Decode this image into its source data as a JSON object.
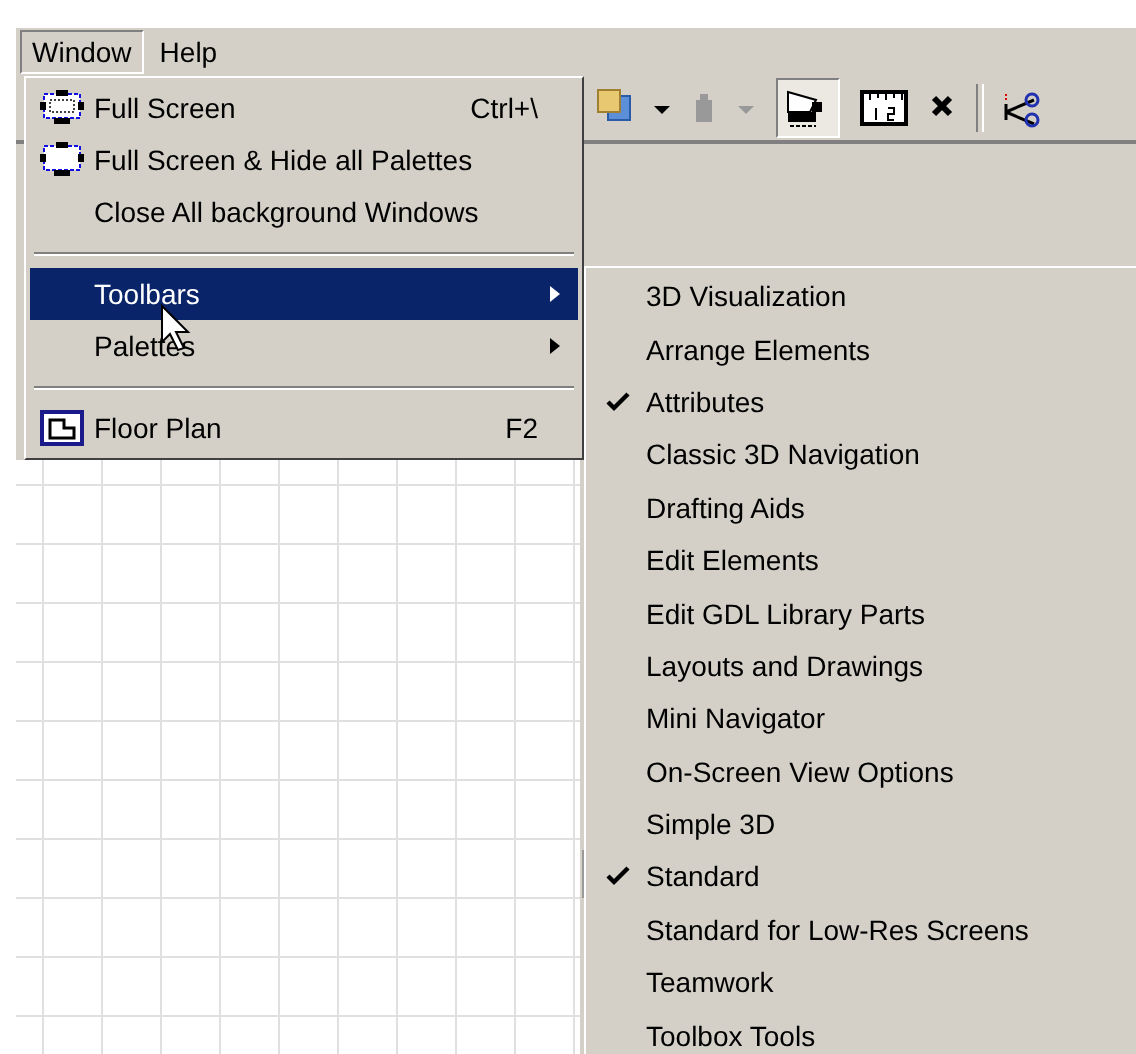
{
  "menubar": [
    {
      "label": "Window",
      "selected": true
    },
    {
      "label": "Help",
      "selected": false
    }
  ],
  "window_menu": {
    "items": [
      {
        "kind": "screen",
        "label": "Full Screen",
        "shortcut": "Ctrl+\\",
        "selected": false
      },
      {
        "kind": "screenhide",
        "label": "Full Screen & Hide all Palettes",
        "selected": false
      },
      {
        "kind": "plain",
        "label": "Close All background Windows",
        "selected": false
      },
      {
        "kind": "separator"
      },
      {
        "kind": "submenu",
        "label": "Toolbars",
        "selected": true
      },
      {
        "kind": "submenu",
        "label": "Palettes",
        "selected": false
      },
      {
        "kind": "separator"
      },
      {
        "kind": "view",
        "label": "Floor Plan",
        "shortcut": "F2",
        "selected": false
      }
    ]
  },
  "toolbars_submenu": {
    "items": [
      {
        "label": "3D Visualization",
        "checked": false
      },
      {
        "label": "Arrange Elements",
        "checked": false
      },
      {
        "label": "Attributes",
        "checked": true
      },
      {
        "label": "Classic 3D Navigation",
        "checked": false
      },
      {
        "label": "Drafting Aids",
        "checked": false
      },
      {
        "label": "Edit Elements",
        "checked": false
      },
      {
        "label": "Edit GDL Library Parts",
        "checked": false
      },
      {
        "label": "Layouts and Drawings",
        "checked": false
      },
      {
        "label": "Mini Navigator",
        "checked": false
      },
      {
        "label": "On-Screen View Options",
        "checked": false
      },
      {
        "label": "Simple 3D",
        "checked": false
      },
      {
        "label": "Standard",
        "checked": true
      },
      {
        "label": "Standard for Low-Res Screens",
        "checked": false
      },
      {
        "label": "Teamwork",
        "checked": false
      },
      {
        "label": "Toolbox Tools",
        "checked": false
      }
    ]
  }
}
